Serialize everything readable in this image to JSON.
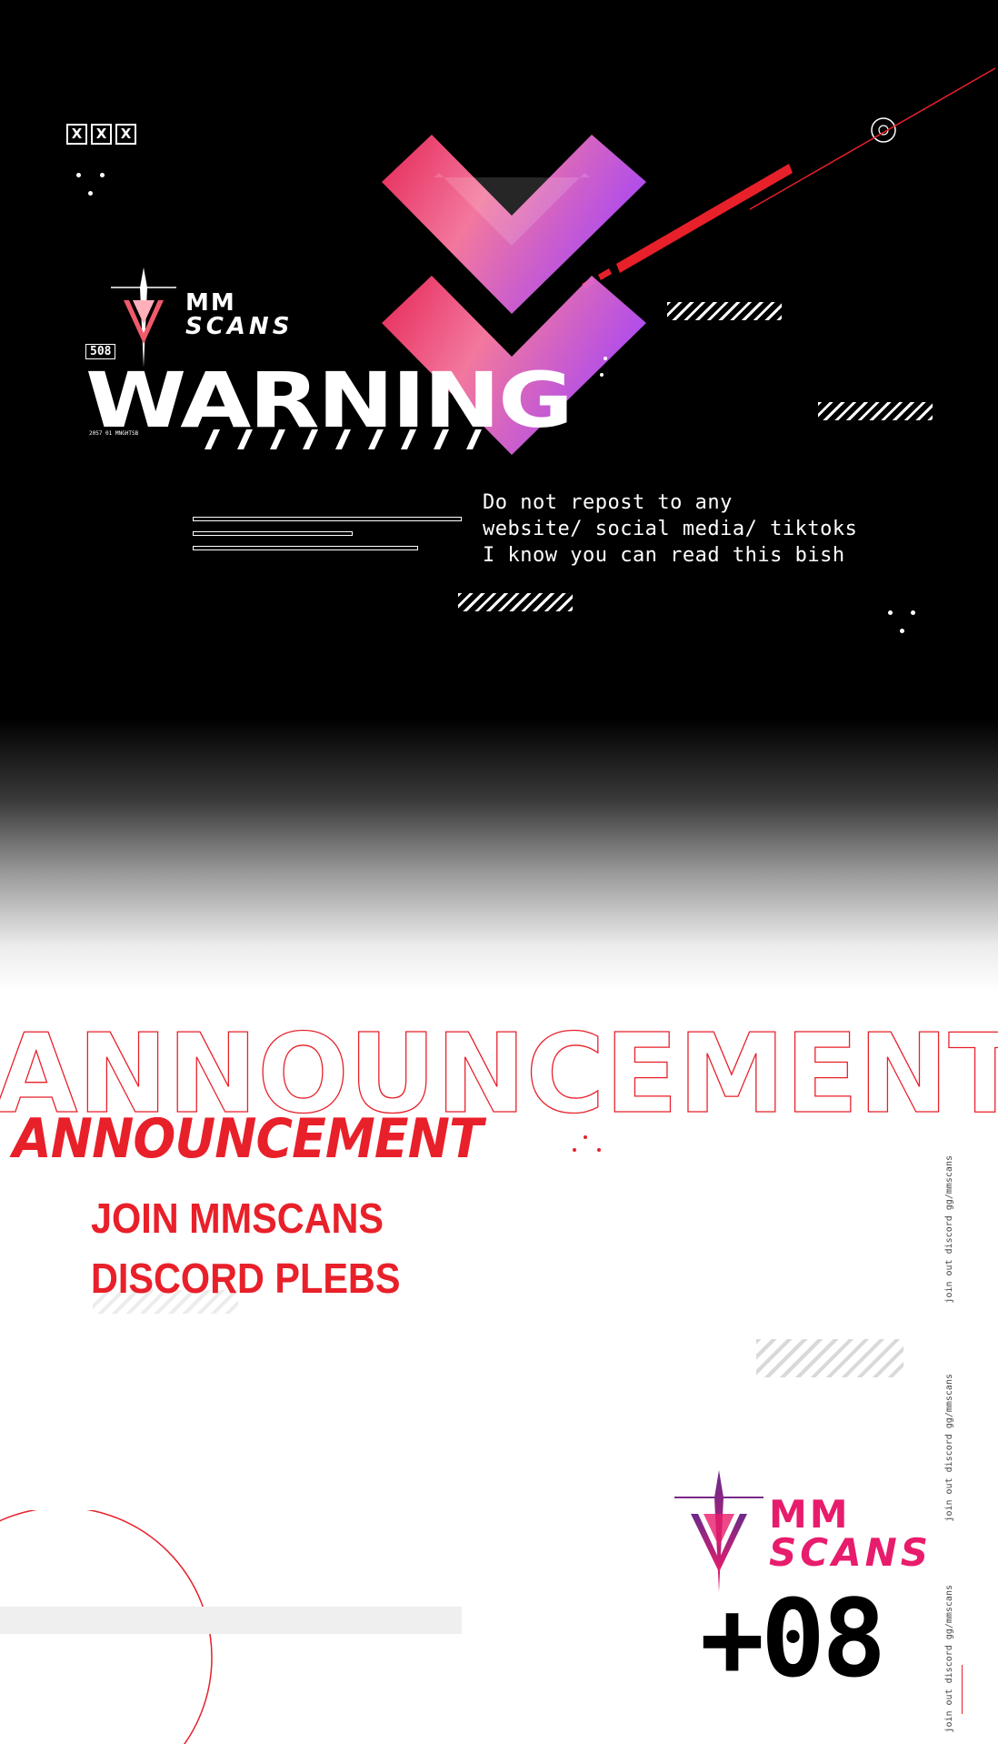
{
  "top": {
    "x_marks": [
      "X",
      "X",
      "X"
    ],
    "badge": "508",
    "brand_line1": "MM",
    "brand_line2": "SCANS",
    "warning_title": "WARNING",
    "micro_label": "2057 01 MNGHTSB",
    "notice_lines": "Do not repost to any\nwebsite/ social media/ tiktoks\nI know you can read this bish"
  },
  "announcement": {
    "outline_word": "ANNOUNCEMENT",
    "title": "ANNOUNCEMENT",
    "message_line1": "JOIN MMSCANS",
    "message_line2": "DISCORD PLEBS",
    "vertical_note_1": "join out discord gg/mmscans",
    "vertical_note_2": "join out discord gg/mmscans",
    "vertical_note_3": "join out discord gg/mmscans"
  },
  "footer": {
    "brand_line1": "MM",
    "brand_line2": "SCANS",
    "counter": "+08"
  },
  "colors": {
    "accent_red": "#e8202a",
    "brand_pink": "#e81c6c",
    "chevron_gradient": [
      "#f2285a",
      "#ff6fa0",
      "#b44dff"
    ],
    "background_dark": "#000000",
    "background_light": "#ffffff"
  }
}
